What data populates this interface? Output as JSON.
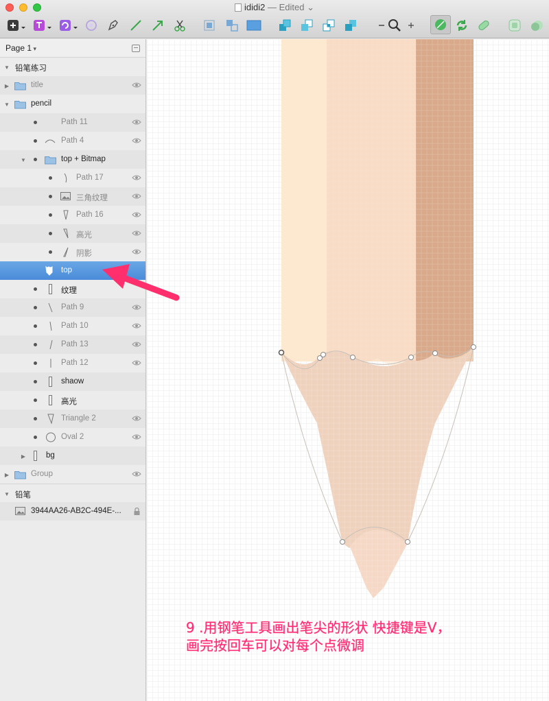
{
  "window": {
    "title": "ididi2",
    "separator": "—",
    "status": "Edited",
    "colors": {
      "close": "#fc5f57",
      "minimize": "#fdbc2e",
      "maximize": "#33c748"
    }
  },
  "toolbar": {
    "tools": [
      {
        "name": "insert-icon"
      },
      {
        "name": "text-icon"
      },
      {
        "name": "symbol-icon"
      },
      {
        "name": "rotate-copies-icon"
      },
      {
        "name": "pen-icon"
      },
      {
        "name": "line-icon"
      },
      {
        "name": "arrow-icon"
      },
      {
        "name": "scissors-icon"
      },
      {
        "name": "group-icon"
      },
      {
        "name": "ungroup-icon"
      },
      {
        "name": "artboard-icon"
      },
      {
        "name": "forward-icon"
      },
      {
        "name": "backward-icon"
      },
      {
        "name": "front-icon"
      },
      {
        "name": "back-icon"
      },
      {
        "name": "zoom-out-icon"
      },
      {
        "name": "zoom-icon"
      },
      {
        "name": "zoom-in-icon"
      },
      {
        "name": "edit-path-icon"
      },
      {
        "name": "rotate-icon"
      },
      {
        "name": "flatten-icon"
      },
      {
        "name": "mask-icon"
      },
      {
        "name": "scale-icon"
      }
    ]
  },
  "sidebar": {
    "page": "Page 1",
    "layers": [
      {
        "label": "铅笔练习",
        "type": "page-header"
      },
      {
        "label": "title",
        "type": "folder",
        "dim": true,
        "eye": true
      },
      {
        "label": "pencil",
        "type": "folder",
        "dim": false,
        "eye": false
      },
      {
        "label": "Path 11",
        "type": "path",
        "dim": true,
        "eye": true
      },
      {
        "label": "Path 4",
        "type": "path",
        "dim": true,
        "eye": true
      },
      {
        "label": "top + Bitmap",
        "type": "folder",
        "dim": false,
        "eye": false
      },
      {
        "label": "Path 17",
        "type": "path",
        "dim": true,
        "eye": true
      },
      {
        "label": "三角纹理",
        "type": "bitmap",
        "dim": true,
        "eye": true
      },
      {
        "label": "Path 16",
        "type": "path",
        "dim": true,
        "eye": true
      },
      {
        "label": "高光",
        "type": "path",
        "dim": true,
        "eye": true
      },
      {
        "label": "阴影",
        "type": "path",
        "dim": true,
        "eye": true
      },
      {
        "label": "top",
        "type": "shape",
        "selected": true
      },
      {
        "label": "纹理",
        "type": "rect",
        "dim": false,
        "eye": false
      },
      {
        "label": "Path 9",
        "type": "path",
        "dim": true,
        "eye": true
      },
      {
        "label": "Path 10",
        "type": "path",
        "dim": true,
        "eye": true
      },
      {
        "label": "Path 13",
        "type": "path",
        "dim": true,
        "eye": true
      },
      {
        "label": "Path 12",
        "type": "path",
        "dim": true,
        "eye": true
      },
      {
        "label": "shaow",
        "type": "rect",
        "dim": false,
        "eye": false
      },
      {
        "label": "高光",
        "type": "rect",
        "dim": false,
        "eye": false
      },
      {
        "label": "Triangle 2",
        "type": "path",
        "dim": true,
        "eye": true
      },
      {
        "label": "Oval 2",
        "type": "oval",
        "dim": true,
        "eye": true
      },
      {
        "label": "bg",
        "type": "rect",
        "dim": false,
        "eye": false
      },
      {
        "label": "Group",
        "type": "folder",
        "dim": true,
        "eye": true
      },
      {
        "label": "铅笔",
        "type": "page-header"
      },
      {
        "label": "3944AA26-AB2C-494E-...",
        "type": "bitmap",
        "locked": true
      }
    ]
  },
  "canvas": {
    "caption_line1": "9 .用钢笔工具画出笔尖的形状  快捷键是V，",
    "caption_line2": "画完按回车可以对每个点微调",
    "caption_color": "#ff2a74"
  }
}
